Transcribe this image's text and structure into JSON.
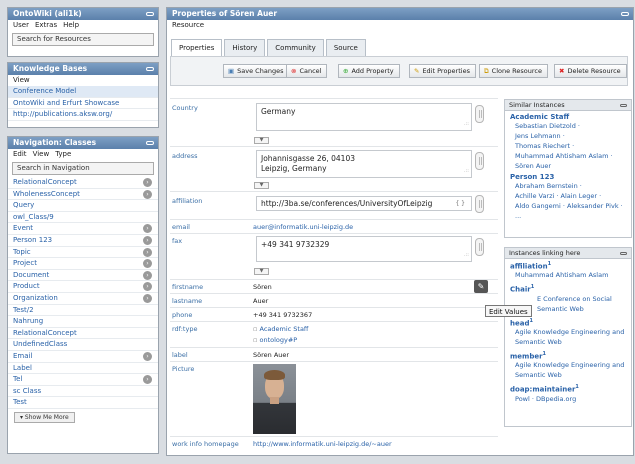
{
  "left_panel": {
    "title": "OntoWiki (ali1k)",
    "menu": [
      "User",
      "Extras",
      "Help"
    ],
    "search": "Search for Resources"
  },
  "kb_panel": {
    "title": "Knowledge Bases",
    "menu": [
      "View"
    ],
    "items": [
      "Conference Model",
      "OntoWiki and Erfurt Showcase",
      "http://publications.aksw.org/"
    ]
  },
  "nav_panel": {
    "title": "Navigation: Classes",
    "menu": [
      "Edit",
      "View",
      "Type"
    ],
    "search": "Search in Navigation",
    "items": [
      {
        "label": "RelationalConcept",
        "arrow": true
      },
      {
        "label": "WholenessConcept",
        "arrow": true
      },
      {
        "label": "Query",
        "arrow": false
      },
      {
        "label": "owl_Class/9",
        "arrow": false
      },
      {
        "label": "Event",
        "arrow": true
      },
      {
        "label": "Person 123",
        "arrow": true
      },
      {
        "label": "Topic",
        "arrow": true
      },
      {
        "label": "Project",
        "arrow": true
      },
      {
        "label": "Document",
        "arrow": true
      },
      {
        "label": "Product",
        "arrow": true
      },
      {
        "label": "Organization",
        "arrow": true
      },
      {
        "label": "Test/2",
        "arrow": false
      },
      {
        "label": "Nahrung",
        "arrow": false
      },
      {
        "label": "RelationalConcept",
        "arrow": false
      },
      {
        "label": "UndefinedClass",
        "arrow": false
      },
      {
        "label": "Email",
        "arrow": true
      },
      {
        "label": "Label",
        "arrow": false
      },
      {
        "label": "Tel",
        "arrow": true
      },
      {
        "label": "sc Class",
        "arrow": false
      },
      {
        "label": "Test",
        "arrow": false
      }
    ],
    "show_more": "Show Me More"
  },
  "main": {
    "title": "Properties of Sören Auer",
    "menu": "Resource",
    "tabs": [
      "Properties",
      "History",
      "Community",
      "Source"
    ],
    "toolbar": {
      "save": "Save Changes",
      "cancel": "Cancel",
      "add": "Add Property",
      "edit": "Edit Properties",
      "clone": "Clone Resource",
      "delete": "Delete Resource"
    },
    "props": {
      "country_label": "Country",
      "country_value": "Germany",
      "address_label": "address",
      "address_line1": "Johannisgasse 26, 04103",
      "address_line2": "Leipzig, Germany",
      "affiliation_label": "affiliation",
      "affiliation_value": "http://3ba.se/conferences/UniversityOfLeipzig",
      "email_label": "email",
      "email_value": "auer@informatik.uni-leipzig.de",
      "fax_label": "fax",
      "fax_value": "+49 341 9732329",
      "firstname_label": "firstname",
      "firstname_value": "Sören",
      "lastname_label": "lastname",
      "lastname_value": "Auer",
      "phone_label": "phone",
      "phone_value": "+49 341 9732367",
      "rdftype_label": "rdf:type",
      "rdftype_v1": "Academic Staff",
      "rdftype_v2": "ontology#P",
      "label_label": "label",
      "label_value": "Sören Auer",
      "picture_label": "Picture",
      "homepage_label": "work info homepage",
      "homepage_value": "http://www.informatik.uni-leipzig.de/~auer",
      "tooltip": "Edit Values"
    }
  },
  "similar": {
    "title": "Similar Instances",
    "g1": "Academic Staff",
    "g1_items": [
      "Sebastian Dietzold ·",
      "Jens Lehmann ·",
      "Thomas Riechert ·",
      "Muhammad Ahtisham Aslam ·",
      "Sören Auer"
    ],
    "g2": "Person 123",
    "g2_items": [
      "Abraham Bernstein ·",
      "Achille Varzi · Alain Leger ·",
      "Aldo Gangemi · Aleksander Pivk ·",
      "..."
    ]
  },
  "linking": {
    "title": "Instances linking here",
    "a_h": "affiliation",
    "a_n": "1",
    "a_v": "Muhammad Ahtisham Aslam",
    "c_h": "Chair",
    "c_n": "1",
    "c_v1": "E Conference on Social",
    "c_v2": "Semantic Web",
    "h_h": "head",
    "h_n": "1",
    "h_v1": "Agile Knowledge Engineering and",
    "h_v2": "Semantic Web",
    "m_h": "member",
    "m_n": "1",
    "m_v1": "Agile Knowledge Engineering and",
    "m_v2": "Semantic Web",
    "d_h": "doap:maintainer",
    "d_n": "1",
    "d_v": "Powl · DBpedia.org"
  }
}
